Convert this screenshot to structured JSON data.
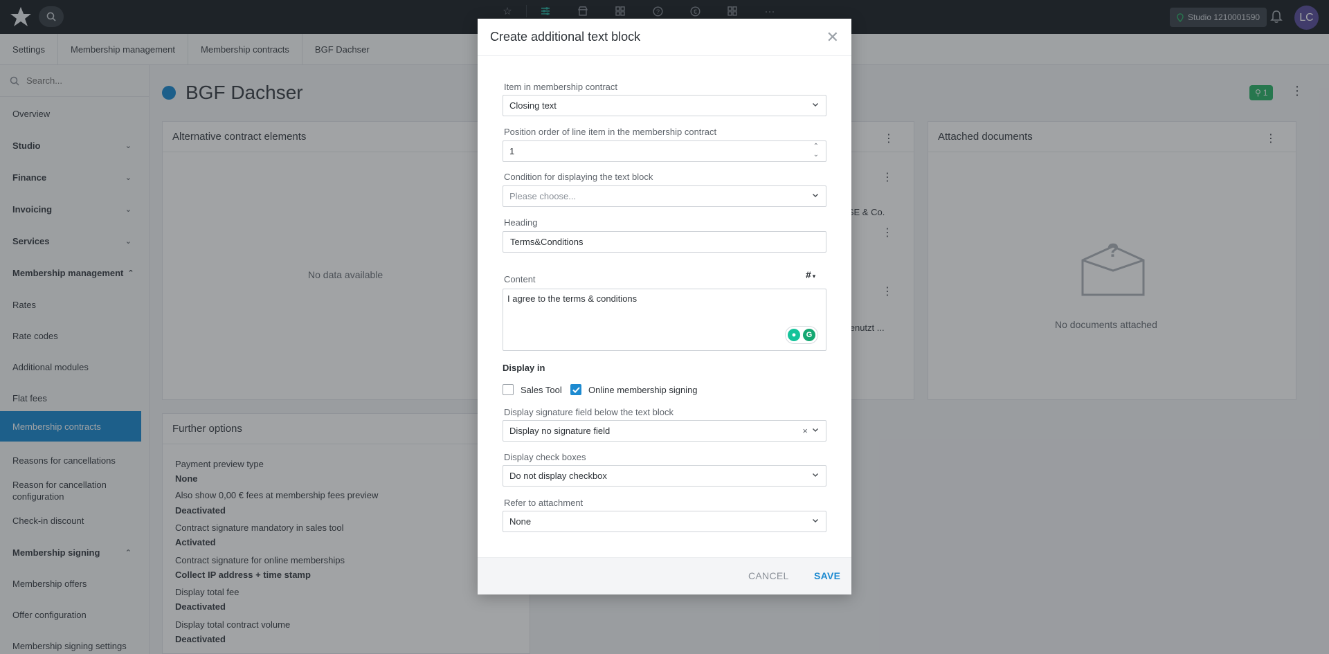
{
  "topbar": {
    "studio_label": "Studio 1210001590",
    "avatar_initials": "LC",
    "icons": [
      "star-icon",
      "sliders-icon",
      "store-icon",
      "modules-icon",
      "help-icon",
      "currency-icon",
      "apps-icon",
      "more-icon"
    ]
  },
  "breadcrumb": [
    "Settings",
    "Membership management",
    "Membership contracts",
    "BGF Dachser"
  ],
  "sidebar": {
    "search_placeholder": "Search...",
    "items": {
      "overview": "Overview",
      "studio": "Studio",
      "finance": "Finance",
      "invoicing": "Invoicing",
      "services": "Services",
      "membership_management": "Membership management",
      "rates": "Rates",
      "rate_codes": "Rate codes",
      "additional_modules": "Additional modules",
      "flat_fees": "Flat fees",
      "membership_contracts": "Membership contracts",
      "reasons_for_cancellations": "Reasons for cancellations",
      "reason_for_cancellation_configuration": "Reason for cancellation configuration",
      "check_in_discount": "Check-in discount",
      "membership_signing": "Membership signing",
      "membership_offers": "Membership offers",
      "offer_configuration": "Offer configuration",
      "membership_signing_settings": "Membership signing settings"
    }
  },
  "page": {
    "title": "BGF Dachser",
    "location_badge": "1",
    "cards": {
      "alternative": {
        "title": "Alternative contract elements",
        "empty": "No data available"
      },
      "middle": {
        "text_a": "p SE & Co.",
        "text_b": "l genutzt ..."
      },
      "attached": {
        "title": "Attached documents",
        "empty": "No documents attached"
      },
      "further": {
        "title": "Further options",
        "rows": [
          {
            "label": "Payment preview type",
            "value": "None"
          },
          {
            "label": "Also show 0,00 € fees at membership fees preview",
            "value": "Deactivated"
          },
          {
            "label": "Contract signature mandatory in sales tool",
            "value": "Activated"
          },
          {
            "label": "Contract signature for online memberships",
            "value": "Collect IP address + time stamp"
          },
          {
            "label": "Display total fee",
            "value": "Deactivated"
          },
          {
            "label": "Display total contract volume",
            "value": "Deactivated"
          }
        ]
      }
    }
  },
  "modal": {
    "title": "Create additional text block",
    "fields": {
      "item": {
        "label": "Item in membership contract",
        "value": "Closing text"
      },
      "position": {
        "label": "Position order of line item in the membership contract",
        "value": "1"
      },
      "condition": {
        "label": "Condition for displaying the text block",
        "placeholder": "Please choose..."
      },
      "heading": {
        "label": "Heading",
        "value": "Terms&Conditions"
      },
      "content": {
        "label": "Content",
        "value": "I agree to the terms & conditions",
        "hash": "#"
      },
      "display_in": {
        "label": "Display in",
        "sales_tool": "Sales Tool",
        "online": "Online membership signing",
        "sales_tool_checked": false,
        "online_checked": true
      },
      "signature": {
        "label": "Display signature field below the text block",
        "value": "Display no signature field",
        "clear": "×"
      },
      "checkboxes": {
        "label": "Display check boxes",
        "value": "Do not display checkbox"
      },
      "attachment": {
        "label": "Refer to attachment",
        "value": "None"
      }
    },
    "cancel_label": "CANCEL",
    "save_label": "SAVE"
  },
  "colors": {
    "accent": "#1d8ad0",
    "topbar": "#1e2329",
    "badge_green": "#2db36a",
    "active_icon": "#2ab0a0"
  }
}
